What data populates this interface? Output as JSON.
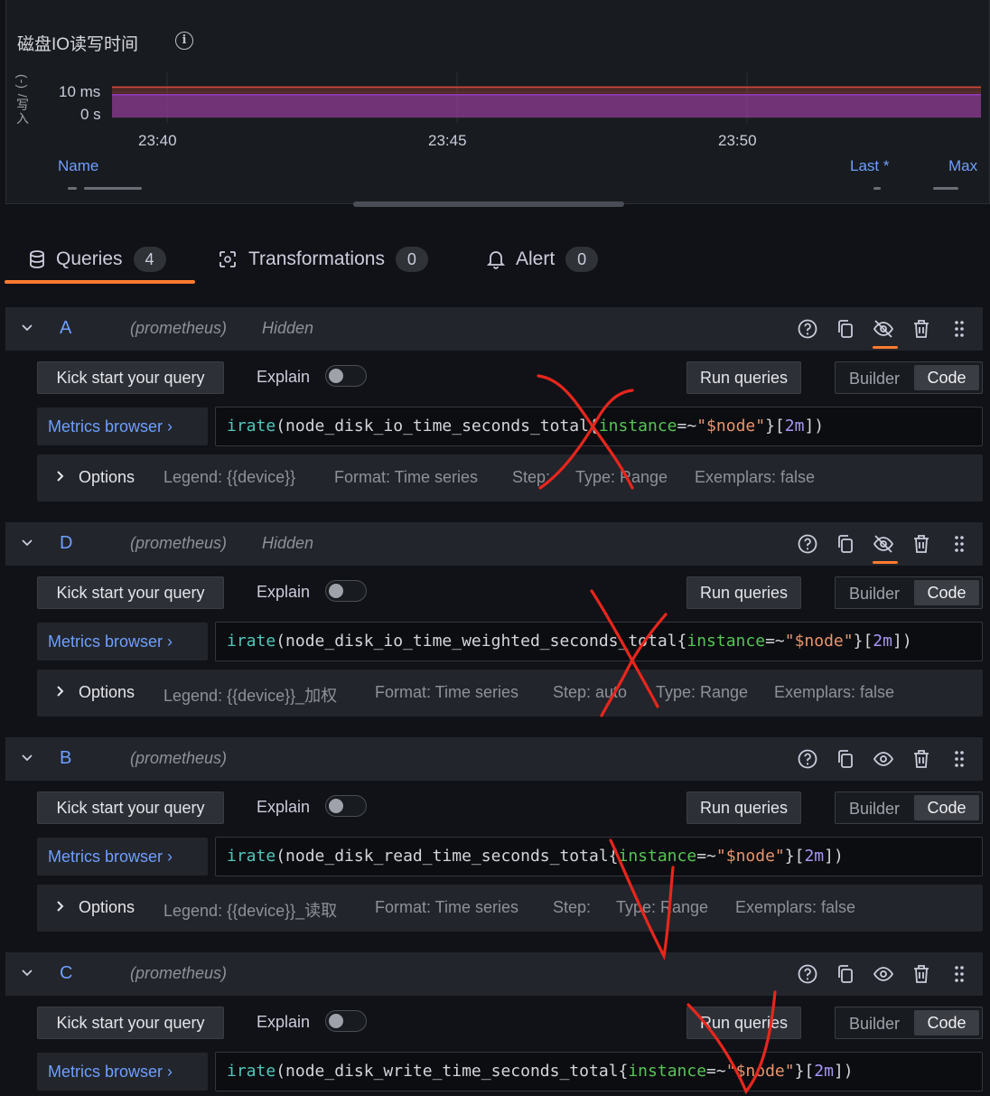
{
  "panel": {
    "title": "磁盘IO读写时间",
    "y_axis_label": "(-) /写入",
    "y_ticks": [
      "10 ms",
      "0 s"
    ],
    "x_ticks": [
      "23:40",
      "23:45",
      "23:50"
    ],
    "legend_headers": {
      "name": "Name",
      "last": "Last *",
      "max": "Max"
    }
  },
  "chart_data": {
    "type": "area",
    "ylabel": "(-) /写入",
    "x_ticks": [
      "23:40",
      "23:45",
      "23:50"
    ],
    "y_ticks": [
      "10 ms",
      "0 s"
    ],
    "series": [
      {
        "color": "#d44a3a",
        "note": "upper line",
        "values": [
          12,
          12,
          12,
          12,
          12,
          12,
          12,
          12,
          12,
          12,
          12,
          12,
          12,
          12,
          12,
          12,
          12,
          12,
          12,
          12,
          12,
          12,
          12,
          12,
          12,
          12,
          12,
          12,
          12,
          12,
          12,
          12,
          12,
          12,
          12,
          12,
          12,
          12,
          12,
          12,
          12,
          12,
          12,
          12,
          12,
          12,
          12,
          12,
          12,
          12,
          12,
          12,
          12,
          12,
          12,
          12,
          12,
          12,
          12,
          12,
          12
        ]
      },
      {
        "color": "#8f3bb8",
        "note": "lower line",
        "values": [
          9,
          9,
          9,
          9,
          9,
          9,
          9,
          9,
          9,
          9,
          9,
          9,
          9,
          9,
          9,
          9,
          9,
          9,
          9,
          9,
          9,
          9,
          9,
          9,
          9,
          9,
          9,
          9,
          9,
          9,
          9,
          9,
          9,
          9,
          9,
          9,
          9,
          9,
          9,
          9,
          9,
          9,
          9,
          9,
          9,
          9,
          9,
          9,
          9,
          9,
          9,
          9,
          9,
          9,
          9,
          9,
          9,
          9,
          9,
          9,
          9
        ]
      }
    ]
  },
  "tabs": [
    {
      "label": "Queries",
      "count": "4"
    },
    {
      "label": "Transformations",
      "count": "0"
    },
    {
      "label": "Alert",
      "count": "0"
    }
  ],
  "common": {
    "kick_start": "Kick start your query",
    "explain": "Explain",
    "run_queries": "Run queries",
    "builder": "Builder",
    "code": "Code",
    "metrics_browser": "Metrics browser",
    "chevron": "›",
    "options": "Options",
    "datasource": "(prometheus)"
  },
  "queries": [
    {
      "ref": "A",
      "hidden": "Hidden",
      "expr": {
        "fn": "irate",
        "metric": "node_disk_io_time_seconds_total",
        "label": "instance",
        "op": "=~",
        "value": "\"$node\"",
        "range": "2m"
      },
      "options": [
        "Legend: {{device}}",
        "Format: Time series",
        "Step:",
        "Type: Range",
        "Exemplars: false"
      ]
    },
    {
      "ref": "D",
      "hidden": "Hidden",
      "expr": {
        "fn": "irate",
        "metric": "node_disk_io_time_weighted_seconds_total",
        "label": "instance",
        "op": "=~",
        "value": "\"$node\"",
        "range": "2m"
      },
      "options": [
        "Legend: {{device}}_加权",
        "Format: Time series",
        "Step: auto",
        "Type: Range",
        "Exemplars: false"
      ]
    },
    {
      "ref": "B",
      "hidden": "",
      "expr": {
        "fn": "irate",
        "metric": "node_disk_read_time_seconds_total",
        "label": "instance",
        "op": "=~",
        "value": "\"$node\"",
        "range": "2m"
      },
      "options": [
        "Legend: {{device}}_读取",
        "Format: Time series",
        "Step:",
        "Type: Range",
        "Exemplars: false"
      ]
    },
    {
      "ref": "C",
      "hidden": "",
      "expr": {
        "fn": "irate",
        "metric": "node_disk_write_time_seconds_total",
        "label": "instance",
        "op": "=~",
        "value": "\"$node\"",
        "range": "2m"
      },
      "options": []
    }
  ],
  "colors": {
    "accent": "#ff7a30",
    "link": "#6e9fff",
    "annotation": "#e8261d"
  }
}
